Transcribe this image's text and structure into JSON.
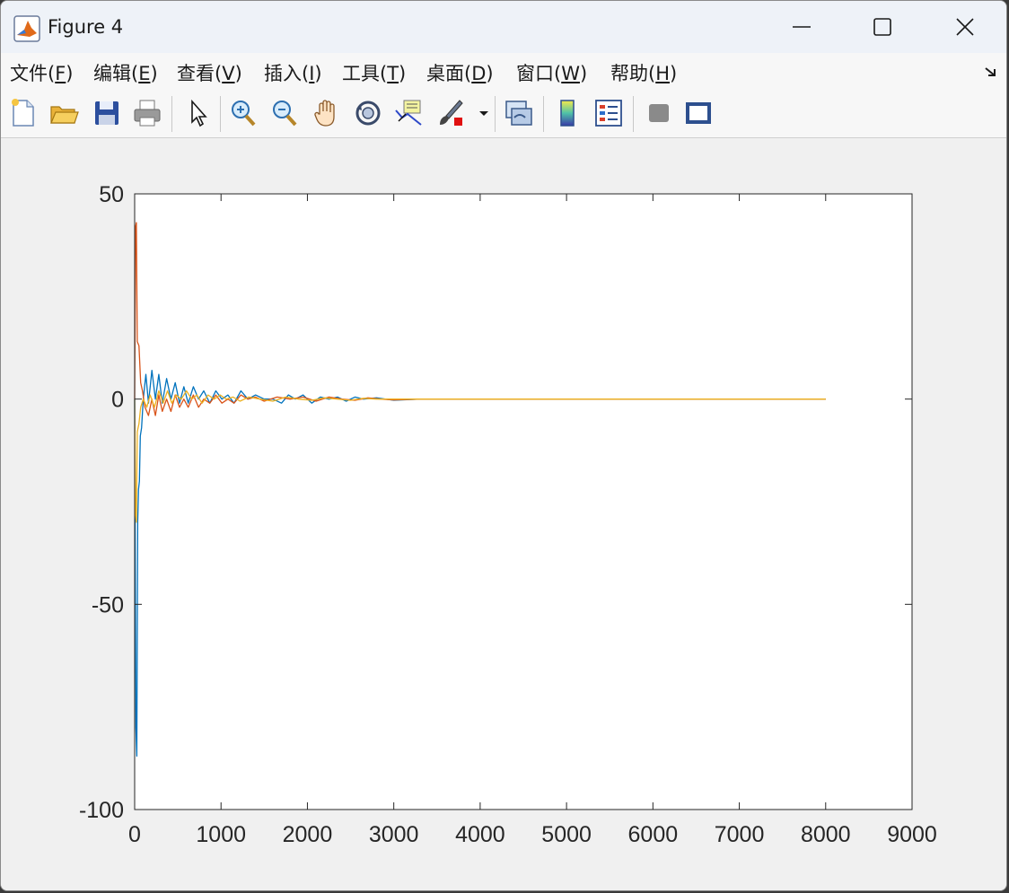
{
  "window": {
    "title": "Figure 4"
  },
  "menu": [
    {
      "label": "文件(",
      "key": "F",
      "tail": ")"
    },
    {
      "label": "编辑(",
      "key": "E",
      "tail": ")"
    },
    {
      "label": "查看(",
      "key": "V",
      "tail": ")"
    },
    {
      "label": "插入(",
      "key": "I",
      "tail": ")"
    },
    {
      "label": "工具(",
      "key": "T",
      "tail": ")"
    },
    {
      "label": "桌面(",
      "key": "D",
      "tail": ")"
    },
    {
      "label": "窗口(",
      "key": "W",
      "tail": ")"
    },
    {
      "label": "帮助(",
      "key": "H",
      "tail": ")"
    }
  ],
  "toolbar": [
    "new-file-icon",
    "open-folder-icon",
    "save-icon",
    "print-icon",
    "pointer-icon",
    "zoom-in-icon",
    "zoom-out-icon",
    "pan-hand-icon",
    "rotate-3d-icon",
    "data-cursor-icon",
    "brush-icon",
    "brush-dropdown-icon",
    "link-plot-icon",
    "colorbar-icon",
    "legend-icon",
    "hide-plot-tools-icon",
    "show-plot-tools-icon"
  ],
  "chart_data": {
    "type": "line",
    "xlim": [
      0,
      9000
    ],
    "ylim": [
      -100,
      50
    ],
    "xticks": [
      0,
      1000,
      2000,
      3000,
      4000,
      5000,
      6000,
      7000,
      8000,
      9000
    ],
    "yticks": [
      -100,
      -50,
      0,
      50
    ],
    "series": [
      {
        "color": "#0072BD",
        "points": [
          [
            0,
            0
          ],
          [
            15,
            -80
          ],
          [
            25,
            -87
          ],
          [
            35,
            -30
          ],
          [
            45,
            -22
          ],
          [
            55,
            -20
          ],
          [
            65,
            -9
          ],
          [
            80,
            -7
          ],
          [
            100,
            0
          ],
          [
            130,
            6
          ],
          [
            160,
            -1
          ],
          [
            200,
            7
          ],
          [
            240,
            0
          ],
          [
            280,
            6
          ],
          [
            320,
            -1
          ],
          [
            370,
            5
          ],
          [
            420,
            0
          ],
          [
            470,
            4
          ],
          [
            520,
            -1
          ],
          [
            570,
            3
          ],
          [
            620,
            -1
          ],
          [
            680,
            3
          ],
          [
            740,
            0
          ],
          [
            800,
            2
          ],
          [
            870,
            -1
          ],
          [
            940,
            2
          ],
          [
            1010,
            0
          ],
          [
            1080,
            1
          ],
          [
            1150,
            -1
          ],
          [
            1230,
            2
          ],
          [
            1310,
            0
          ],
          [
            1400,
            1
          ],
          [
            1500,
            0
          ],
          [
            1600,
            0
          ],
          [
            1700,
            -1
          ],
          [
            1780,
            1
          ],
          [
            1860,
            0
          ],
          [
            1950,
            1
          ],
          [
            2050,
            -1
          ],
          [
            2150,
            0.5
          ],
          [
            2250,
            0
          ],
          [
            2350,
            0.5
          ],
          [
            2450,
            -0.5
          ],
          [
            2550,
            0.5
          ],
          [
            2650,
            0
          ],
          [
            2800,
            0.3
          ],
          [
            3000,
            -0.3
          ],
          [
            3300,
            0
          ],
          [
            4000,
            0
          ],
          [
            8000,
            0
          ]
        ]
      },
      {
        "color": "#D95319",
        "points": [
          [
            0,
            0
          ],
          [
            10,
            42
          ],
          [
            20,
            43
          ],
          [
            30,
            14
          ],
          [
            50,
            13
          ],
          [
            70,
            4
          ],
          [
            90,
            2
          ],
          [
            120,
            -2
          ],
          [
            160,
            -4
          ],
          [
            200,
            0
          ],
          [
            240,
            -4
          ],
          [
            280,
            1
          ],
          [
            320,
            -3
          ],
          [
            370,
            0
          ],
          [
            420,
            -3
          ],
          [
            470,
            1
          ],
          [
            520,
            -2
          ],
          [
            570,
            0
          ],
          [
            620,
            -2
          ],
          [
            680,
            1
          ],
          [
            740,
            -2
          ],
          [
            800,
            0
          ],
          [
            870,
            -1
          ],
          [
            940,
            1
          ],
          [
            1010,
            -1
          ],
          [
            1080,
            0
          ],
          [
            1150,
            -1
          ],
          [
            1230,
            1
          ],
          [
            1310,
            0
          ],
          [
            1400,
            0.5
          ],
          [
            1500,
            -0.5
          ],
          [
            1650,
            0.5
          ],
          [
            1800,
            0
          ],
          [
            1950,
            0.5
          ],
          [
            2100,
            -0.5
          ],
          [
            2250,
            0.5
          ],
          [
            2400,
            0
          ],
          [
            2550,
            -0.3
          ],
          [
            2700,
            0.3
          ],
          [
            2850,
            0
          ],
          [
            3000,
            -0.2
          ],
          [
            3300,
            0
          ],
          [
            4000,
            0
          ],
          [
            8000,
            0
          ]
        ]
      },
      {
        "color": "#EDB120",
        "points": [
          [
            0,
            0
          ],
          [
            10,
            -28
          ],
          [
            20,
            -30
          ],
          [
            30,
            -8
          ],
          [
            50,
            -6
          ],
          [
            70,
            -2
          ],
          [
            100,
            0
          ],
          [
            140,
            -2
          ],
          [
            180,
            1
          ],
          [
            230,
            -2
          ],
          [
            280,
            2
          ],
          [
            330,
            -1
          ],
          [
            380,
            2
          ],
          [
            430,
            -1
          ],
          [
            480,
            1
          ],
          [
            540,
            0
          ],
          [
            600,
            2
          ],
          [
            660,
            0
          ],
          [
            720,
            1
          ],
          [
            780,
            -1
          ],
          [
            850,
            1
          ],
          [
            920,
            0
          ],
          [
            990,
            1
          ],
          [
            1060,
            0
          ],
          [
            1140,
            0.5
          ],
          [
            1220,
            -0.5
          ],
          [
            1320,
            0.5
          ],
          [
            1450,
            0
          ],
          [
            1600,
            -0.5
          ],
          [
            1750,
            0.5
          ],
          [
            1900,
            0
          ],
          [
            2050,
            -0.3
          ],
          [
            2200,
            0.3
          ],
          [
            2350,
            0
          ],
          [
            2500,
            -0.3
          ],
          [
            2650,
            0.2
          ],
          [
            2800,
            0
          ],
          [
            3000,
            0
          ],
          [
            4000,
            0
          ],
          [
            8000,
            0
          ]
        ]
      }
    ]
  }
}
